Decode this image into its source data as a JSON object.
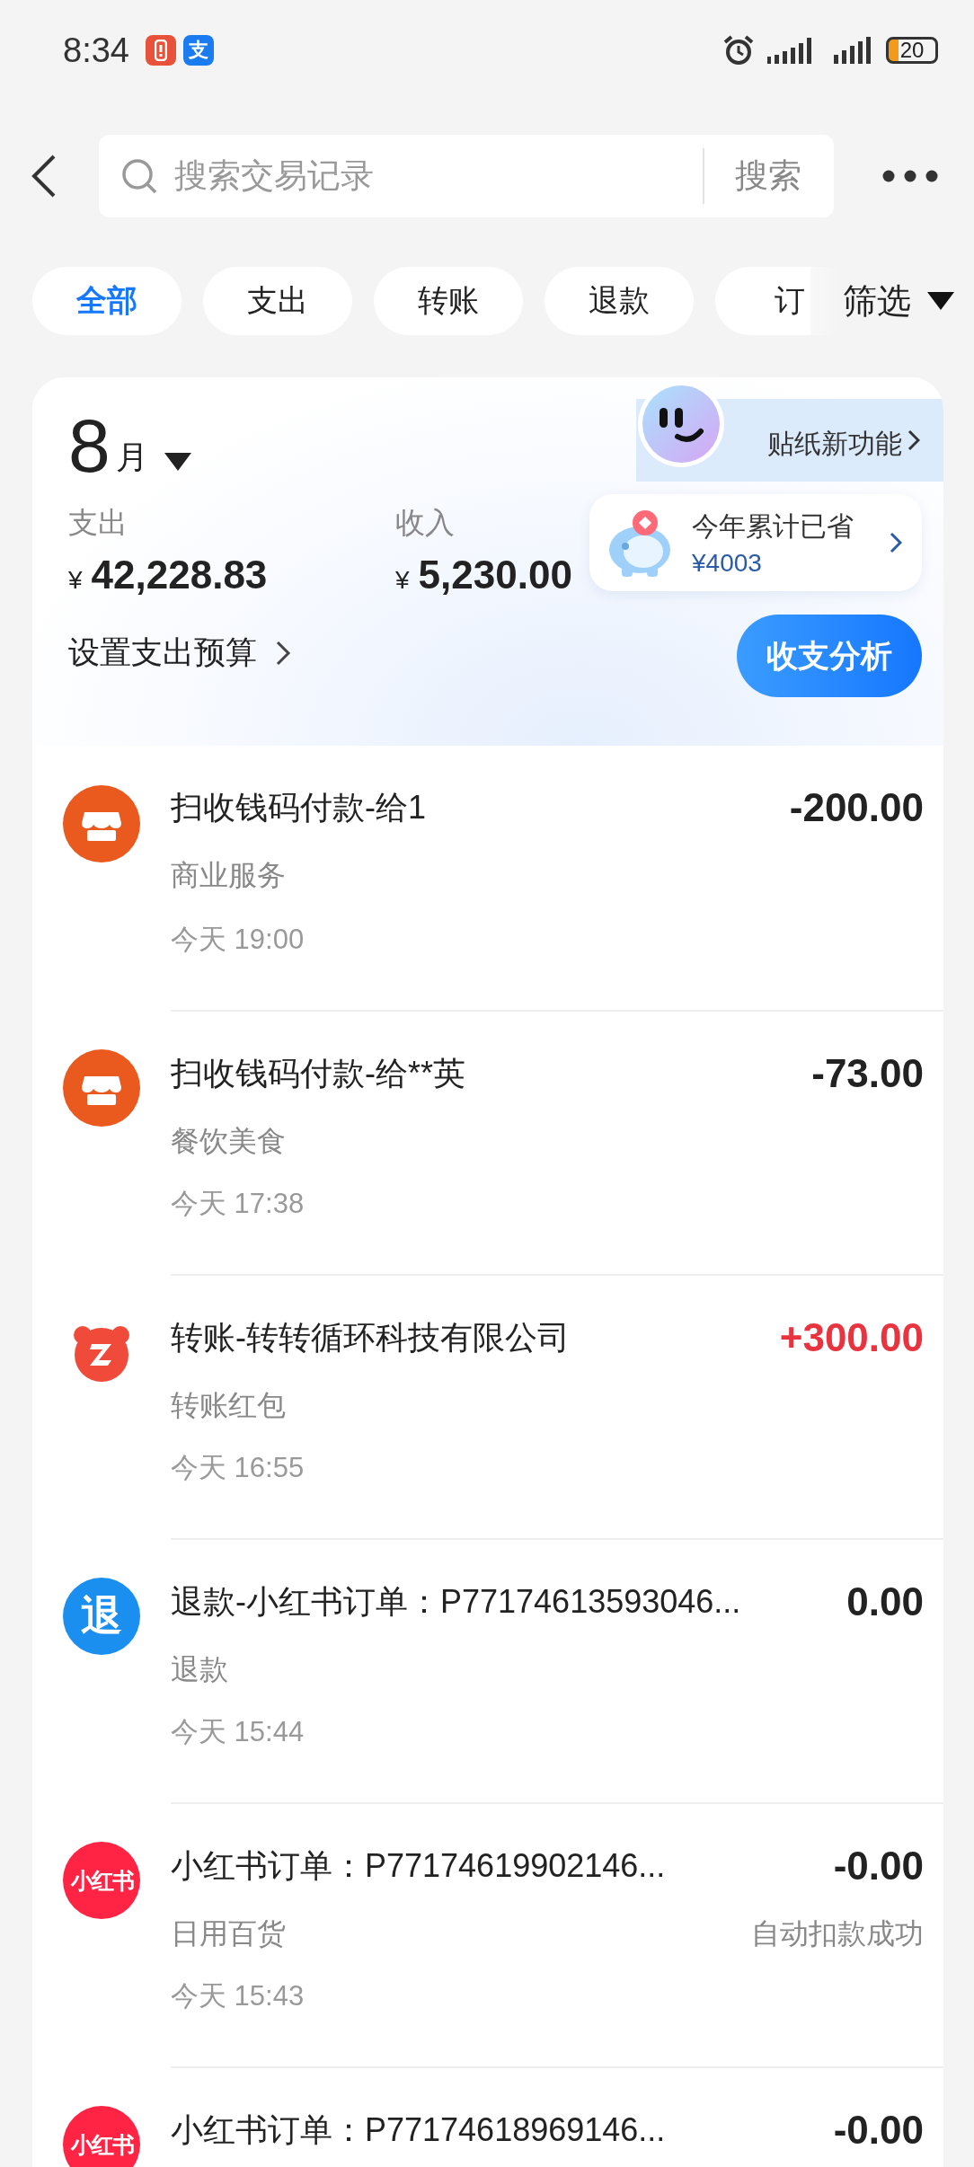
{
  "status_bar": {
    "time": "8:34",
    "app_badges": [
      {
        "kind": "alert"
      },
      {
        "kind": "pay",
        "glyph": "支"
      }
    ],
    "battery": "20"
  },
  "search": {
    "placeholder": "搜索交易记录",
    "button": "搜索"
  },
  "filters": [
    {
      "label": "全部",
      "selected": true
    },
    {
      "label": "支出",
      "selected": false
    },
    {
      "label": "转账",
      "selected": false
    },
    {
      "label": "退款",
      "selected": false
    },
    {
      "label": "订",
      "selected": false
    }
  ],
  "filter_menu": "筛选",
  "summary": {
    "month": "8",
    "month_unit": "月",
    "expense": {
      "label": "支出",
      "currency": "¥",
      "amount": "42,228.83"
    },
    "income": {
      "label": "收入",
      "currency": "¥",
      "amount": "5,230.00"
    },
    "budget_link": "设置支出预算",
    "sticker": "贴纸新功能",
    "savings": {
      "label": "今年累计已省",
      "amount": "¥4003"
    },
    "analysis_button": "收支分析"
  },
  "transactions": [
    {
      "icon": {
        "kind": "shop"
      },
      "title": "扫收钱码付款-给1",
      "category": "商业服务",
      "time": "今天 19:00",
      "amount": "-200.00",
      "income": false
    },
    {
      "icon": {
        "kind": "shop"
      },
      "title": "扫收钱码付款-给**英",
      "category": "餐饮美食",
      "time": "今天 17:38",
      "amount": "-73.00",
      "income": false
    },
    {
      "icon": {
        "kind": "transfer"
      },
      "title": "转账-转转循环科技有限公司",
      "category": "转账红包",
      "time": "今天 16:55",
      "amount": "+300.00",
      "income": true
    },
    {
      "icon": {
        "kind": "refund",
        "glyph": "退"
      },
      "title": "退款-小红书订单：P77174613593046...",
      "category": "退款",
      "time": "今天 15:44",
      "amount": "0.00",
      "income": false
    },
    {
      "icon": {
        "kind": "brand",
        "glyph": "小红书"
      },
      "title": "小红书订单：P77174619902146...",
      "category": "日用百货",
      "status": "自动扣款成功",
      "time": "今天 15:43",
      "amount": "-0.00",
      "income": false
    },
    {
      "icon": {
        "kind": "brand",
        "glyph": "小红书"
      },
      "title": "小红书订单：P77174618969146...",
      "amount": "-0.00",
      "income": false
    }
  ]
}
